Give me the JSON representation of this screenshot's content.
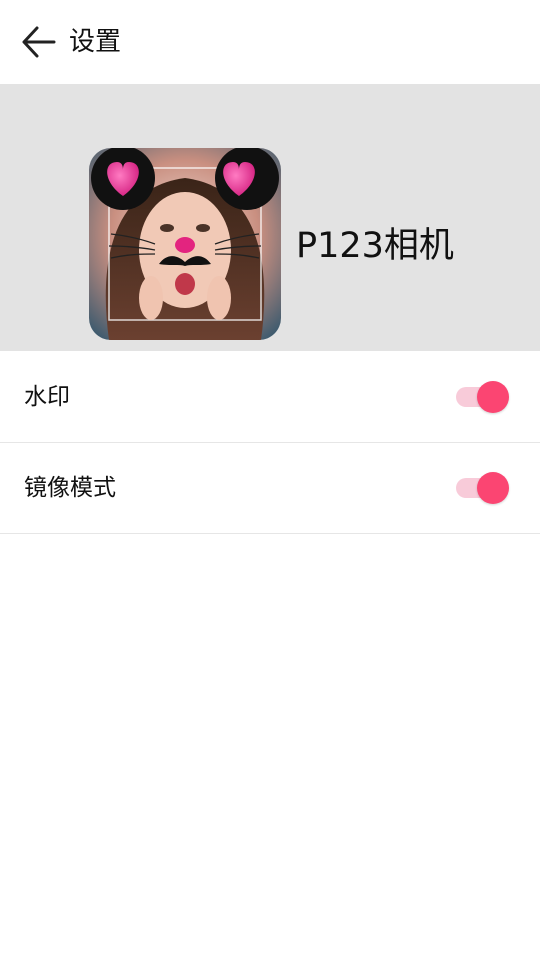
{
  "toolbar": {
    "back_icon": "arrow-left-icon",
    "title": "设置"
  },
  "banner": {
    "app_icon": "app-logo-cat-filter-photo",
    "app_name": "P123相机"
  },
  "settings": {
    "items": [
      {
        "label": "水印",
        "enabled": true
      },
      {
        "label": "镜像模式",
        "enabled": true
      }
    ]
  },
  "colors": {
    "accent": "#fb4572",
    "toggle_track": "#f8cbd9",
    "banner_bg": "#e3e3e3"
  }
}
